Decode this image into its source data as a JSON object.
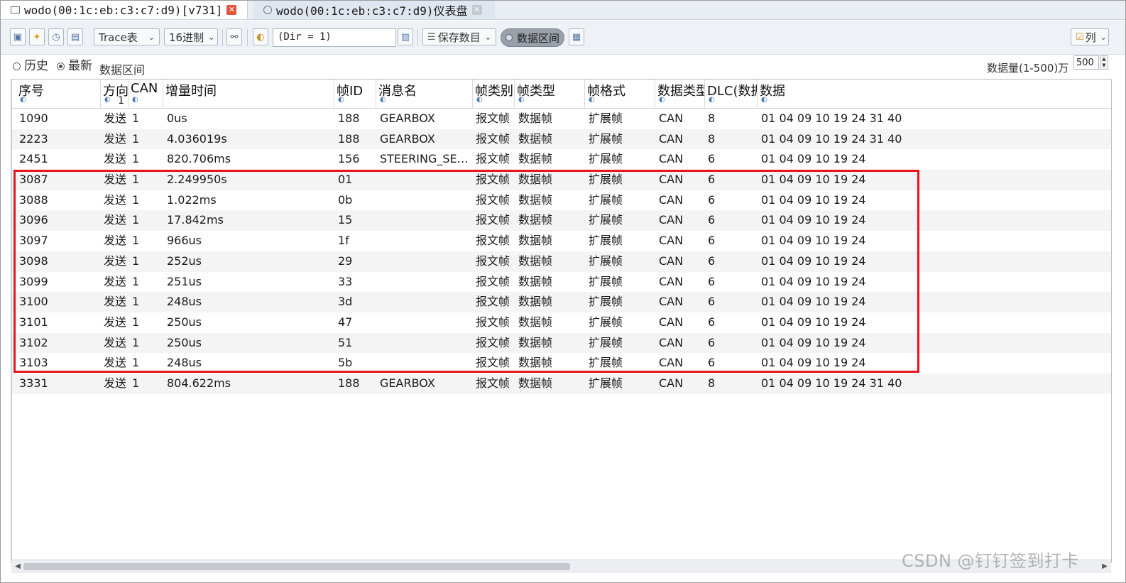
{
  "tabs": [
    {
      "title": "wodo(00:1c:eb:c3:c7:d9)[v731]",
      "active": true
    },
    {
      "title": "wodo(00:1c:eb:c3:c7:d9)仪表盘",
      "active": false
    }
  ],
  "toolbar": {
    "view_select": "Trace表",
    "radix_select": "16进制",
    "filter_value": "(Dir = 1)",
    "save_select": "保存数目",
    "range_toggle": "数据区间",
    "columns_button": "列"
  },
  "options": {
    "history_label": "历史",
    "latest_label": "最新",
    "range_label": "数据区间",
    "quantity_label": "数据量(1-500)万",
    "quantity_value": "500"
  },
  "columns": [
    {
      "label": "序号"
    },
    {
      "label": "方向",
      "sub": "1"
    },
    {
      "label": "CAN"
    },
    {
      "label": "增量时间"
    },
    {
      "label": "帧ID"
    },
    {
      "label": "消息名"
    },
    {
      "label": "帧类别"
    },
    {
      "label": "帧类型"
    },
    {
      "label": "帧格式"
    },
    {
      "label": "数据类型"
    },
    {
      "label": "DLC(数据)"
    },
    {
      "label": "数据"
    }
  ],
  "rows": [
    [
      "1090",
      "发送",
      "1",
      "0us",
      "188",
      "GEARBOX",
      "报文帧",
      "数据帧",
      "扩展帧",
      "CAN",
      "8",
      "01 04 09 10 19 24 31 40"
    ],
    [
      "2223",
      "发送",
      "1",
      "4.036019s",
      "188",
      "GEARBOX",
      "报文帧",
      "数据帧",
      "扩展帧",
      "CAN",
      "8",
      "01 04 09 10 19 24 31 40"
    ],
    [
      "2451",
      "发送",
      "1",
      "820.706ms",
      "156",
      "STEERING_SEN...",
      "报文帧",
      "数据帧",
      "扩展帧",
      "CAN",
      "6",
      "01 04 09 10 19 24"
    ],
    [
      "3087",
      "发送",
      "1",
      "2.249950s",
      "01",
      "",
      "报文帧",
      "数据帧",
      "扩展帧",
      "CAN",
      "6",
      "01 04 09 10 19 24"
    ],
    [
      "3088",
      "发送",
      "1",
      "1.022ms",
      "0b",
      "",
      "报文帧",
      "数据帧",
      "扩展帧",
      "CAN",
      "6",
      "01 04 09 10 19 24"
    ],
    [
      "3096",
      "发送",
      "1",
      "17.842ms",
      "15",
      "",
      "报文帧",
      "数据帧",
      "扩展帧",
      "CAN",
      "6",
      "01 04 09 10 19 24"
    ],
    [
      "3097",
      "发送",
      "1",
      "966us",
      "1f",
      "",
      "报文帧",
      "数据帧",
      "扩展帧",
      "CAN",
      "6",
      "01 04 09 10 19 24"
    ],
    [
      "3098",
      "发送",
      "1",
      "252us",
      "29",
      "",
      "报文帧",
      "数据帧",
      "扩展帧",
      "CAN",
      "6",
      "01 04 09 10 19 24"
    ],
    [
      "3099",
      "发送",
      "1",
      "251us",
      "33",
      "",
      "报文帧",
      "数据帧",
      "扩展帧",
      "CAN",
      "6",
      "01 04 09 10 19 24"
    ],
    [
      "3100",
      "发送",
      "1",
      "248us",
      "3d",
      "",
      "报文帧",
      "数据帧",
      "扩展帧",
      "CAN",
      "6",
      "01 04 09 10 19 24"
    ],
    [
      "3101",
      "发送",
      "1",
      "250us",
      "47",
      "",
      "报文帧",
      "数据帧",
      "扩展帧",
      "CAN",
      "6",
      "01 04 09 10 19 24"
    ],
    [
      "3102",
      "发送",
      "1",
      "250us",
      "51",
      "",
      "报文帧",
      "数据帧",
      "扩展帧",
      "CAN",
      "6",
      "01 04 09 10 19 24"
    ],
    [
      "3103",
      "发送",
      "1",
      "248us",
      "5b",
      "",
      "报文帧",
      "数据帧",
      "扩展帧",
      "CAN",
      "6",
      "01 04 09 10 19 24"
    ],
    [
      "3331",
      "发送",
      "1",
      "804.622ms",
      "188",
      "GEARBOX",
      "报文帧",
      "数据帧",
      "扩展帧",
      "CAN",
      "8",
      "01 04 09 10 19 24 31 40"
    ]
  ],
  "watermark": "CSDN @钉钉签到打卡",
  "colors": {
    "highlight": "#e8131d",
    "close_active": "#e0533f"
  }
}
